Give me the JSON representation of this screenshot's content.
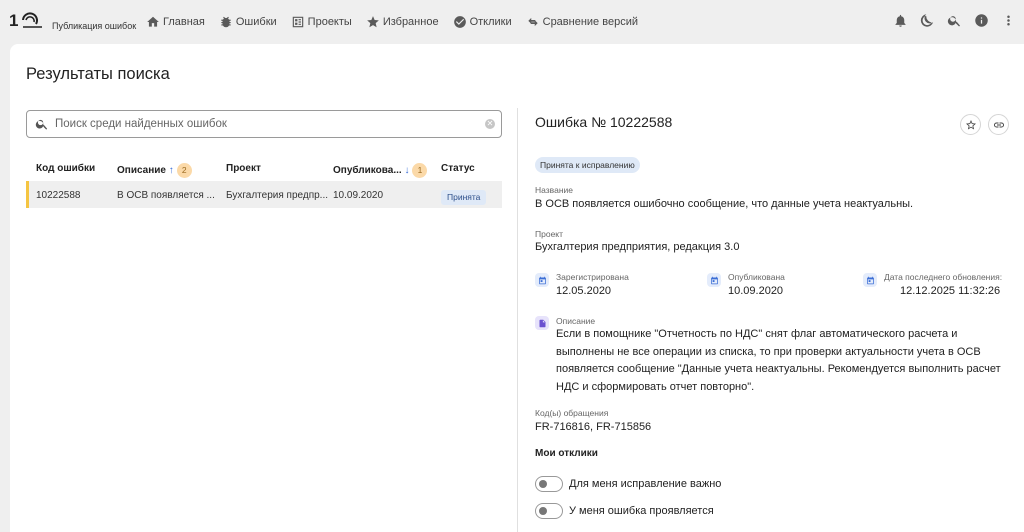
{
  "app": {
    "name": "Публикация ошибок",
    "logo": "1С"
  },
  "nav": {
    "home": "Главная",
    "errors": "Ошибки",
    "projects": "Проекты",
    "favorites": "Избранное",
    "responses": "Отклики",
    "compare": "Сравнение версий"
  },
  "page": {
    "title": "Результаты поиска"
  },
  "search": {
    "placeholder": "Поиск среди найденных ошибок"
  },
  "table": {
    "headers": {
      "code": "Код ошибки",
      "description": "Описание",
      "description_sort_index": "2",
      "project": "Проект",
      "published": "Опубликова...",
      "published_sort_index": "1",
      "status": "Статус"
    },
    "rows": [
      {
        "code": "10222588",
        "description": "В ОСВ появляется ...",
        "project": "Бухгалтерия предпр...",
        "published": "10.09.2020",
        "status": "Принята"
      }
    ]
  },
  "details": {
    "title": "Ошибка № 10222588",
    "status": "Принята к исправлению",
    "name_label": "Название",
    "name": "В ОСВ появляется ошибочно сообщение, что данные учета неактуальны.",
    "project_label": "Проект",
    "project": "Бухгалтерия предприятия, редакция 3.0",
    "registered_label": "Зарегистрирована",
    "registered": "12.05.2020",
    "published_label": "Опубликована",
    "published": "10.09.2020",
    "updated_label": "Дата последнего обновления:",
    "updated": "12.12.2025 11:32:26",
    "description_label": "Описание",
    "description": "Если в помощнике \"Отчетность по НДС\" снят флаг автоматического расчета и выполнены не все операции из списка, то при проверки актуальности учета в ОСВ появляется сообщение \"Данные учета неактуальны. Рекомендуется выполнить расчет НДС и сформировать отчет повторно\".",
    "requests_label": "Код(ы) обращения",
    "requests": "FR-716816, FR-715856",
    "my_responses": "Мои отклики",
    "toggle_important": "Для меня исправление важно",
    "toggle_reproduces": "У меня ошибка проявляется"
  },
  "colors": {
    "accent_yellow": "#f5c542",
    "status_bg": "#dfe9f7",
    "sort_badge": "#fbd9a8"
  }
}
